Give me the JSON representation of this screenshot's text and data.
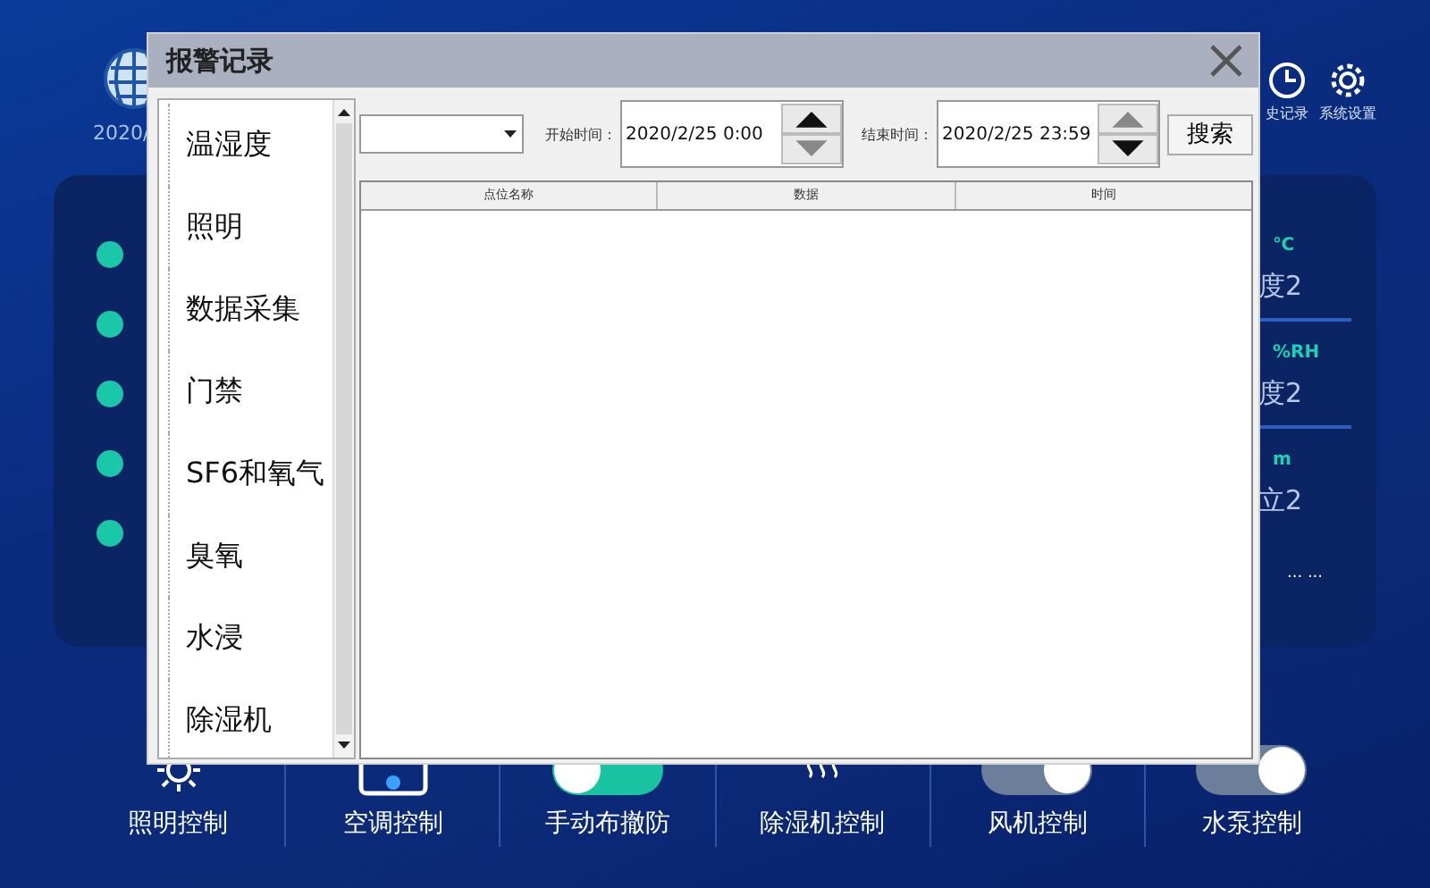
{
  "dashboard": {
    "date": "2020/",
    "header_buttons": [
      {
        "label": "史记录"
      },
      {
        "label": "系统设置"
      }
    ],
    "right_panel": {
      "rows": [
        {
          "unit": "℃",
          "label": "度2"
        },
        {
          "unit": "%RH",
          "label": "度2"
        },
        {
          "unit": "m",
          "label": "立2"
        }
      ],
      "more": "... ..."
    },
    "controls": [
      {
        "label": "照明控制",
        "kind": "lamp"
      },
      {
        "label": "空调控制",
        "kind": "aircon"
      },
      {
        "label": "手动布撤防",
        "kind": "toggle",
        "on": false
      },
      {
        "label": "除湿机控制",
        "kind": "heat"
      },
      {
        "label": "风机控制",
        "kind": "toggle",
        "on": true
      },
      {
        "label": "水泵控制",
        "kind": "toggle",
        "on": true
      }
    ]
  },
  "dialog": {
    "title": "报警记录",
    "categories": [
      {
        "label": "温湿度"
      },
      {
        "label": "照明"
      },
      {
        "label": "数据采集"
      },
      {
        "label": "门禁"
      },
      {
        "label": "SF6和氧气"
      },
      {
        "label": "臭氧"
      },
      {
        "label": "水浸"
      },
      {
        "label": "除湿机"
      }
    ],
    "start": {
      "label": "开始时间：",
      "value": "2020/2/25 0:00",
      "up_disabled": false,
      "down_disabled": true
    },
    "end": {
      "label": "结束时间：",
      "value": "2020/2/25 23:59",
      "up_disabled": true,
      "down_disabled": false
    },
    "search_button": "搜索",
    "table": {
      "columns": [
        "点位名称",
        "数据",
        "时间"
      ]
    }
  }
}
